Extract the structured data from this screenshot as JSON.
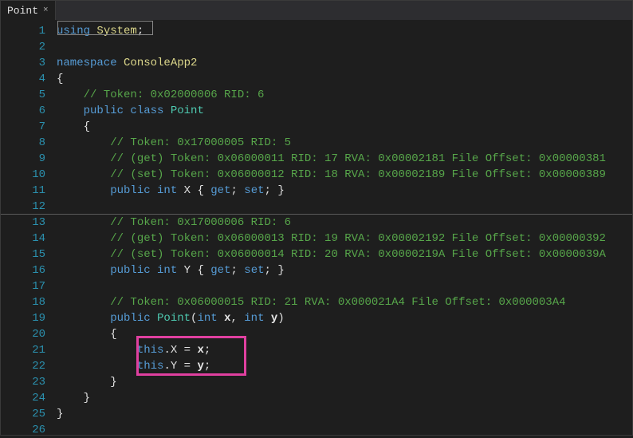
{
  "tab": {
    "title": "Point",
    "close": "×"
  },
  "lines": {
    "count": 26,
    "l1": {
      "a": "using ",
      "b": "System",
      "c": ";"
    },
    "l3": {
      "a": "namespace ",
      "b": "ConsoleApp2"
    },
    "l4": "{",
    "l5": "    // Token: 0x02000006 RID: 6",
    "l6": {
      "a": "    ",
      "b": "public ",
      "c": "class ",
      "d": "Point"
    },
    "l7": "    {",
    "l8": "        // Token: 0x17000005 RID: 5",
    "l9": "        // (get) Token: 0x06000011 RID: 17 RVA: 0x00002181 File Offset: 0x00000381",
    "l10": "        // (set) Token: 0x06000012 RID: 18 RVA: 0x00002189 File Offset: 0x00000389",
    "l11": {
      "a": "        ",
      "b": "public ",
      "c": "int ",
      "d": "X ",
      "e": "{ ",
      "f": "get",
      "g": "; ",
      "h": "set",
      "i": "; }"
    },
    "l13": "        // Token: 0x17000006 RID: 6",
    "l14": "        // (get) Token: 0x06000013 RID: 19 RVA: 0x00002192 File Offset: 0x00000392",
    "l15": "        // (set) Token: 0x06000014 RID: 20 RVA: 0x0000219A File Offset: 0x0000039A",
    "l16": {
      "a": "        ",
      "b": "public ",
      "c": "int ",
      "d": "Y ",
      "e": "{ ",
      "f": "get",
      "g": "; ",
      "h": "set",
      "i": "; }"
    },
    "l18": "        // Token: 0x06000015 RID: 21 RVA: 0x000021A4 File Offset: 0x000003A4",
    "l19": {
      "a": "        ",
      "b": "public ",
      "c": "Point",
      "d": "(",
      "e": "int ",
      "f": "x",
      "g": ", ",
      "h": "int ",
      "i": "y",
      "j": ")"
    },
    "l20": "        {",
    "l21": {
      "a": "            ",
      "b": "this",
      "c": ".X = ",
      "d": "x",
      "e": ";"
    },
    "l22": {
      "a": "            ",
      "b": "this",
      "c": ".Y = ",
      "d": "y",
      "e": ";"
    },
    "l23": "        }",
    "l24": "    }",
    "l25": "}"
  }
}
